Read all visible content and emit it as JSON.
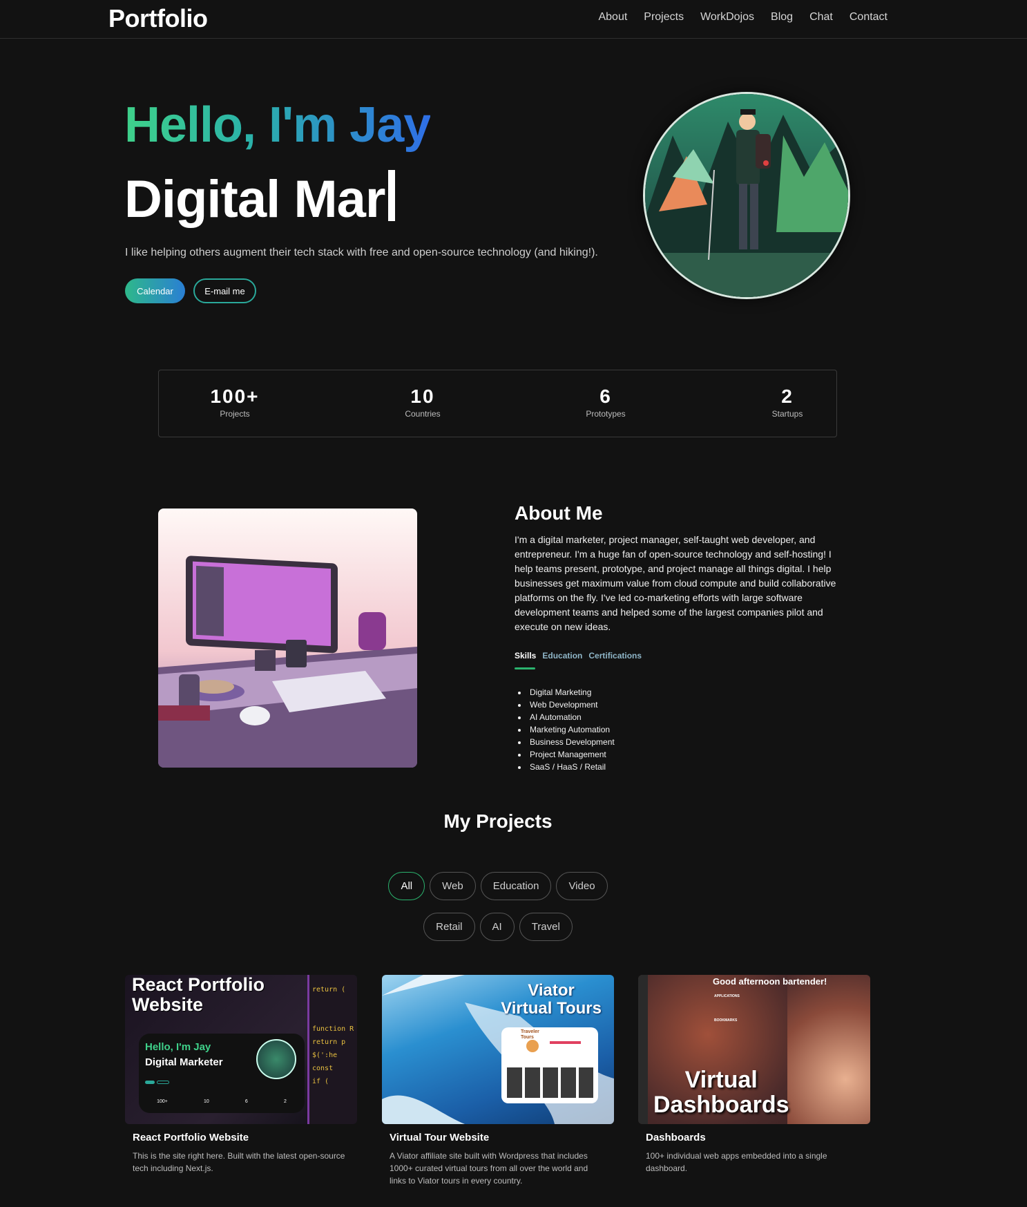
{
  "nav": {
    "brand": "Portfolio",
    "links": [
      "About",
      "Projects",
      "WorkDojos",
      "Blog",
      "Chat",
      "Contact"
    ]
  },
  "hero": {
    "greeting": "Hello, I'm Jay",
    "role_typed": "Digital Mar",
    "tagline": "I like helping others augment their tech stack with free and open-source technology (and hiking!).",
    "calendar_button": "Calendar",
    "email_button": "E-mail me"
  },
  "stats": [
    {
      "value": "100+",
      "label": "Projects"
    },
    {
      "value": "10",
      "label": "Countries"
    },
    {
      "value": "6",
      "label": "Prototypes"
    },
    {
      "value": "2",
      "label": "Startups"
    }
  ],
  "about": {
    "title": "About Me",
    "text": "I'm a digital marketer, project manager, self-taught web developer, and entrepreneur. I'm a huge fan of open-source technology and self-hosting! I help teams present, prototype, and project manage all things digital. I help businesses get maximum value from cloud compute and build collaborative platforms on the fly. I've led co-marketing efforts with large software development teams and helped some of the largest companies pilot and execute on new ideas.",
    "tabs": [
      "Skills",
      "Education",
      "Certifications"
    ],
    "skills": [
      "Digital Marketing",
      "Web Development",
      "AI Automation",
      "Marketing Automation",
      "Business Development",
      "Project Management",
      "SaaS / HaaS / Retail"
    ]
  },
  "projects": {
    "title": "My Projects",
    "filters_row1": [
      "All",
      "Web",
      "Education",
      "Video"
    ],
    "filters_row2": [
      "Retail",
      "AI",
      "Travel"
    ],
    "cards": [
      {
        "thumb_title": "React Portfolio Website",
        "thumb_hello": "Hello, I'm Jay",
        "thumb_role": "Digital Marketer",
        "thumb_stats": [
          "100+",
          "10",
          "6",
          "2"
        ],
        "code_lines": [
          "return (",
          "function R",
          "return p",
          "$(':he",
          "const",
          "if ("
        ],
        "title": "React Portfolio Website",
        "desc": "This is the site right here. Built with the latest open-source tech including Next.js."
      },
      {
        "thumb_title_1": "Viator",
        "thumb_title_2": "Virtual Tours",
        "thumb_brand": "Traveler Tours",
        "title": "Virtual Tour Website",
        "desc": "A Viator affiliate site built with Wordpress that includes 1000+ curated virtual tours from all over the world and links to Viator tours in every country."
      },
      {
        "thumb_greeting": "Good afternoon bartender!",
        "thumb_title_1": "Virtual",
        "thumb_title_2": "Dashboards",
        "thumb_applications": "APPLICATIONS",
        "thumb_bookmarks": "BOOKMARKS",
        "title": "Dashboards",
        "desc": "100+ individual web apps embedded into a single dashboard."
      }
    ]
  }
}
